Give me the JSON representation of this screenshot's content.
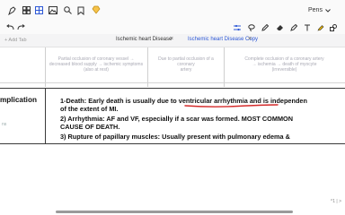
{
  "toolbar": {
    "icons": [
      "pen-icon",
      "grid-icon",
      "layout-icon",
      "image-icon",
      "search-icon",
      "cloud-icon"
    ],
    "pens_label": "Pens",
    "right_icons": [
      "pencil-icon",
      "lasso-icon",
      "text-icon",
      "eraser-icon",
      "highlighter-icon",
      "shapes-icon"
    ]
  },
  "toolbar2": {
    "left_icons": [
      "undo-icon",
      "redo-icon"
    ],
    "right_icons": [
      "settings-sliders-icon",
      "shape-icon",
      "highlighter-icon",
      "eraser-icon",
      "pen-icon",
      "more-icon"
    ]
  },
  "tabs": {
    "add_label": "+ Add Tab",
    "items": [
      {
        "label": "Ischemic heart Disease",
        "active": false
      },
      {
        "label": "Ischemic heart Disease Copy",
        "active": true
      }
    ],
    "active_color": "#2d58d6"
  },
  "table": {
    "faint_cells": [
      [
        "Partial occlusion of coronary vessel →",
        "decreased blood supply → ischemic symptoms",
        "(also at rest)"
      ],
      [
        "Due to partial occlusion of a coronary",
        "artery"
      ],
      [
        "Complete occlusion of a coronary artery",
        "→ ischemia → death of myocyte",
        "(irreversible)"
      ]
    ],
    "row_label": "mplication",
    "margin_note": "ns",
    "lines": [
      "1-Death: Early death is usually due to ventricular arrhythmia and is independen",
      "of the extent of MI.",
      "2) Arrhythmia: AF and VF, especially if a scar was formed. MOST COMMON",
      "CAUSE OF DEATH.",
      "3) Rupture of papillary muscles: Usually present with pulmonary edema &"
    ],
    "underline_color": "#d42a2a"
  },
  "footer": {
    "page_indicator": "^1 | >"
  }
}
